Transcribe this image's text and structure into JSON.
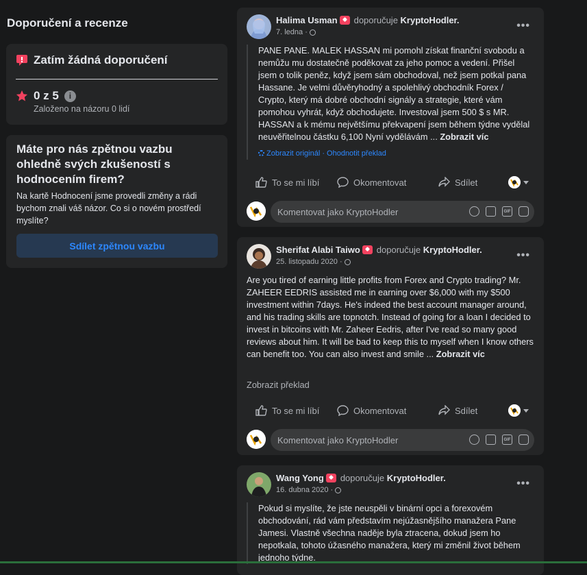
{
  "left": {
    "title": "Doporučení a recenze",
    "no_recs": "Zatím žádná doporučení",
    "rating": "0 z 5",
    "based_on": "Založeno na názoru 0 lidí",
    "feedback_question": "Máte pro nás zpětnou vazbu ohledně svých zkušeností s hodnocením firem?",
    "feedback_desc": "Na kartě Hodnocení jsme provedli změny a rádi bychom znali váš názor. Co si o novém prostředí myslíte?",
    "feedback_button": "Sdílet zpětnou vazbu",
    "accent": "#2d88ff",
    "rec_color": "#f3425f"
  },
  "common": {
    "recommends": "doporučuje",
    "page": "KryptoHodler.",
    "like": "To se mi líbí",
    "comment": "Okomentovat",
    "share": "Sdílet",
    "comment_placeholder": "Komentovat jako KryptoHodler",
    "show_more": "Zobrazit víc",
    "more_dots": "•••"
  },
  "posts": [
    {
      "author": "Halima Usman",
      "date": "7. ledna ·",
      "text": "PANE PANE. MALEK HASSAN mi pomohl získat finanční svobodu a nemůžu mu dostatečně poděkovat za jeho pomoc a vedení. Přišel jsem o tolik peněz, když jsem sám obchodoval, než jsem potkal pana Hassane. Je velmi důvěryhodný a spolehlivý obchodník Forex / Crypto, který má dobré obchodní signály a strategie, které vám pomohou vyhrát, když obchodujete. Investoval jsem 500 $ s MR. HASSAN a k mému největšímu překvapení jsem během týdne vydělal neuvěřitelnou částku 6,100 Nyní vydělávám ...",
      "translation": "Zobrazit originál · Ohodnotit překlad"
    },
    {
      "author": "Sherifat Alabi Taiwo",
      "date": "25. listopadu 2020 ·",
      "text": "Are you tired of earning little profits from Forex and Crypto trading? Mr. ZAHEER EEDRIS assisted me in earning over $6,000 with my $500 investment within 7days. He's indeed the best account manager around, and his trading skills are topnotch. Instead of going for a loan I decided to invest in bitcoins with Mr. Zaheer Eedris, after I've read so many good reviews about him. It will be bad to keep this to myself when I know others can benefit too. You can also invest and smile ...",
      "translation": "Zobrazit překlad"
    },
    {
      "author": "Wang Yong",
      "date": "16. dubna 2020 ·",
      "text": "Pokud si myslíte, že jste neuspěli v binární opci a forexovém obchodování, rád vám představím nejúžasnějšího manažera Pane Jamesi. Vlastně všechna naděje byla ztracena, dokud jsem ho nepotkala, tohoto úžasného manažera, který mi změnil život během jednoho týdne."
    }
  ]
}
